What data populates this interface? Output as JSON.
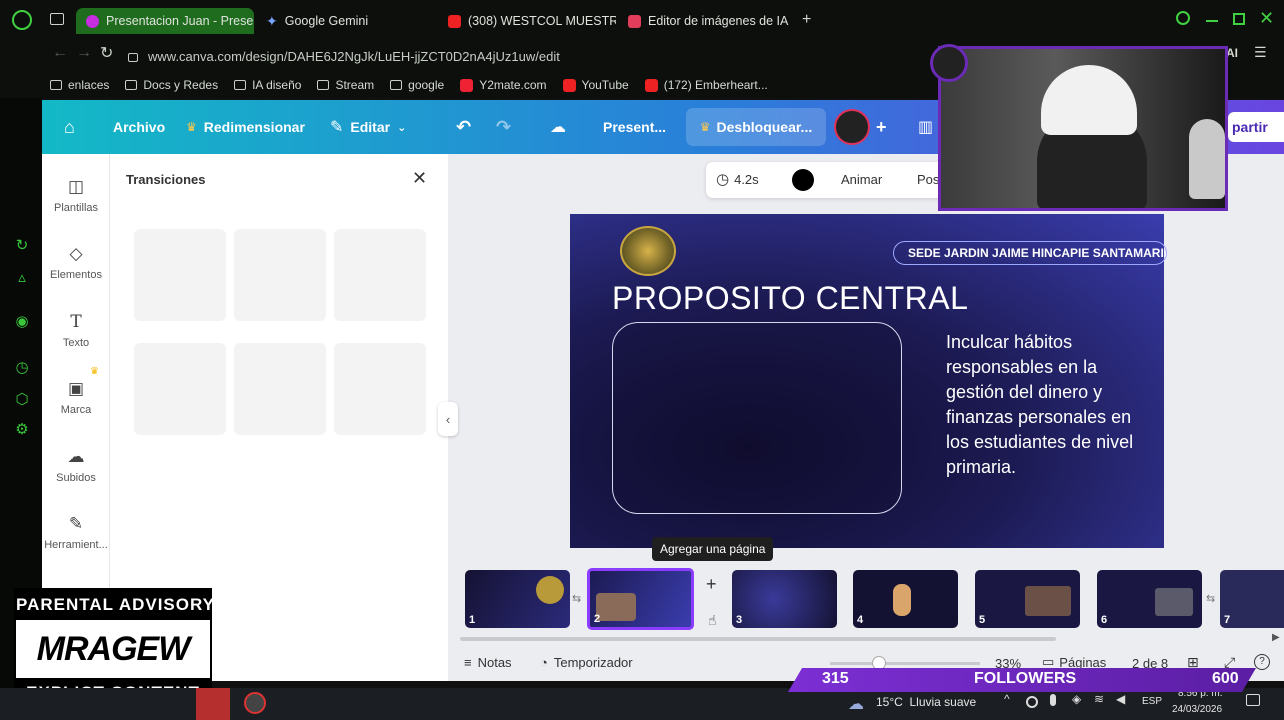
{
  "browser": {
    "tabs": [
      {
        "label": "Presentacion Juan - Prese",
        "favicon": "#c62ce0",
        "active": true
      },
      {
        "label": "Google Gemini",
        "favicon": "#6a8cf7",
        "active": false
      },
      {
        "label": "(308) WESTCOL MUESTR",
        "favicon": "#e22",
        "active": false
      },
      {
        "label": "Editor de imágenes de IA",
        "favicon": "#e23d5b",
        "active": false
      }
    ],
    "url": "www.canva.com/design/DAHE6J2NgJk/LuEH-jjZCT0D2nA4jUz1uw/edit",
    "bookmarks": [
      "enlaces",
      "Docs y Redes",
      "IA diseño",
      "Stream",
      "google",
      "Y2mate.com",
      "YouTube",
      "(172) Emberheart..."
    ]
  },
  "canva_header": {
    "file": "Archivo",
    "resize": "Redimensionar",
    "edit": "Editar",
    "title": "Present...",
    "unlock": "Desbloquear...",
    "share": "partir"
  },
  "sidebar": [
    {
      "label": "Plantillas",
      "icon": "layout-icon"
    },
    {
      "label": "Elementos",
      "icon": "shapes-icon"
    },
    {
      "label": "Texto",
      "icon": "text-icon"
    },
    {
      "label": "Marca",
      "icon": "brand-icon"
    },
    {
      "label": "Subidos",
      "icon": "cloud-upload-icon"
    },
    {
      "label": "Herramient...",
      "icon": "tools-icon"
    }
  ],
  "panel": {
    "title": "Transiciones"
  },
  "toolbar": {
    "duration": "4.2s",
    "animate": "Animar",
    "position": "Pos"
  },
  "slide": {
    "badge": "SEDE JARDIN JAIME HINCAPIE SANTAMARIA",
    "title": "PROPOSITO CENTRAL",
    "body": "Inculcar hábitos responsables en la gestión del dinero y finanzas personales en los estudiantes de nivel primaria."
  },
  "tooltip": "Agregar una página",
  "thumbnails": [
    "1",
    "2",
    "3",
    "4",
    "5",
    "6",
    "7"
  ],
  "footer": {
    "notes": "Notas",
    "timer": "Temporizador",
    "zoom": "33%",
    "pages": "Páginas",
    "page_count": "2 de 8"
  },
  "stream": {
    "followers_current": "315",
    "followers_label": "FOLLOWERS",
    "followers_goal": "600",
    "advisory_top": "PARENTAL ADVISORY",
    "advisory_logo": "MRAGEW",
    "advisory_bottom": "EXPLICT CONTENT"
  },
  "taskbar": {
    "weather": "15°C  Lluvia suave",
    "lang": "ESP",
    "time": "8:56 p. m.",
    "date": "24/03/2026"
  },
  "colors": {
    "accent": "#8b3dff",
    "browser_green": "#1f6c1f",
    "stream_purple": "#7c2fd4"
  }
}
